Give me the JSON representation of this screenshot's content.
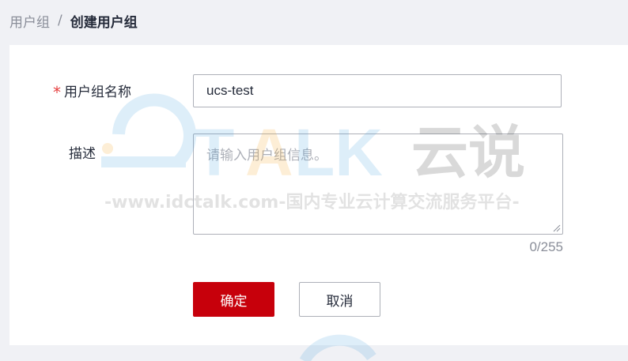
{
  "breadcrumb": {
    "parent": "用户组",
    "separator": "/",
    "current": "创建用户组"
  },
  "form": {
    "name_label": "用户组名称",
    "name_value": "ucs-test",
    "desc_label": "描述",
    "desc_placeholder": "请输入用户组信息。",
    "desc_value": "",
    "counter": "0/255",
    "confirm_label": "确定",
    "cancel_label": "取消"
  },
  "watermark": {
    "brand": "TALK 云说",
    "tagline": "-www.idctalk.com-国内专业云计算交流服务平台-"
  },
  "colors": {
    "primary": "#c7000b",
    "required": "#e63e3e",
    "background": "#f0f1f5",
    "border": "#adb0b8"
  }
}
